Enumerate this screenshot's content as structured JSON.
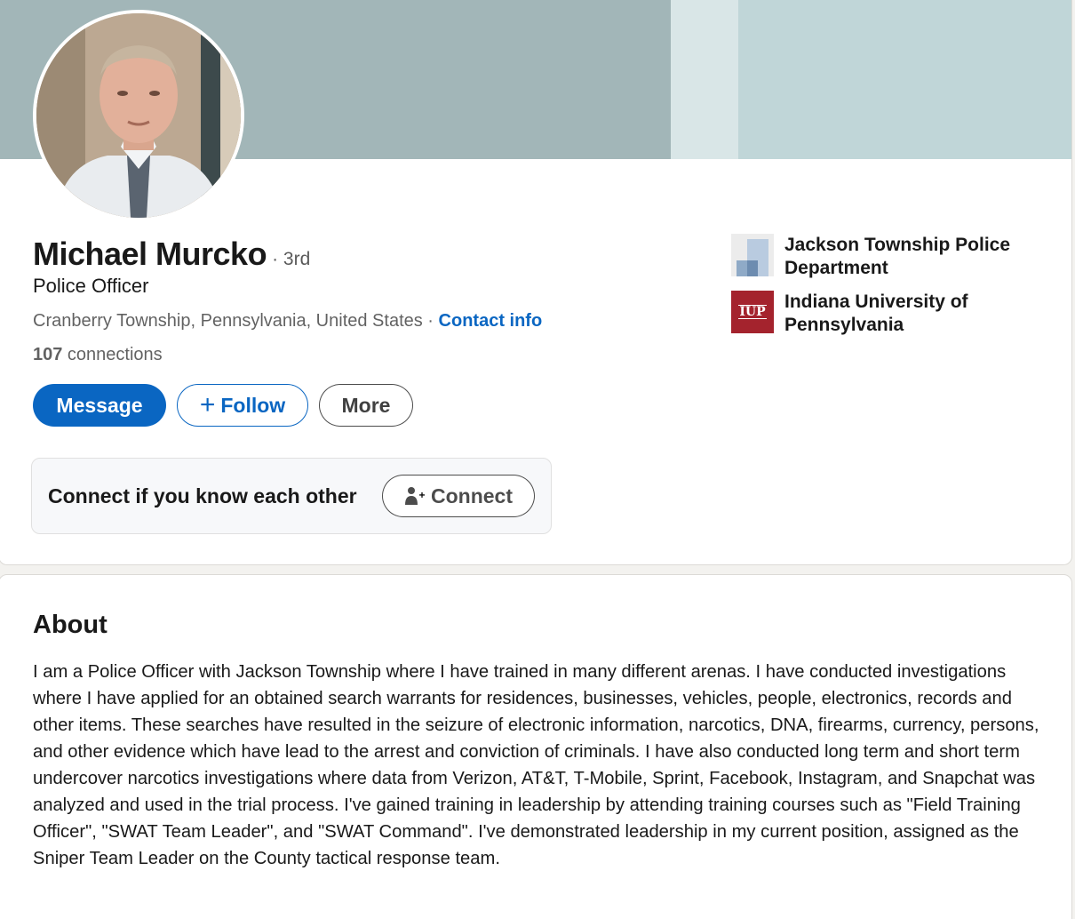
{
  "profile": {
    "name": "Michael Murcko",
    "degree": "· 3rd",
    "headline": "Police Officer",
    "location": "Cranberry Township, Pennsylvania, United States",
    "location_separator": " · ",
    "contact_info_label": "Contact info",
    "connections_count": "107",
    "connections_label": " connections"
  },
  "actions": {
    "message_label": "Message",
    "follow_icon": "+",
    "follow_label": "Follow",
    "more_label": "More"
  },
  "connect_prompt": {
    "text": "Connect if you know each other",
    "button_label": "Connect"
  },
  "organizations": [
    {
      "name": "Jackson Township Police Department",
      "logo": "jackson-township-logo"
    },
    {
      "name": "Indiana University of Pennsylvania",
      "logo_text": "IUP"
    }
  ],
  "about": {
    "title": "About",
    "text": "I am a Police Officer with Jackson Township where I have trained in many different arenas. I have conducted investigations where I have applied for an obtained search warrants for residences, businesses, vehicles, people, electronics, records and other items. These searches have resulted in the seizure of electronic information, narcotics, DNA, firearms, currency, persons, and other evidence which have lead to the arrest and conviction of criminals. I have also conducted long term and short term undercover narcotics investigations where data from Verizon, AT&T, T-Mobile, Sprint, Facebook, Instagram, and Snapchat was analyzed and used in the trial process. I've gained training in leadership by attending training courses such as \"Field Training Officer\", \"SWAT Team Leader\", and \"SWAT Command\". I've demonstrated leadership in my current position, assigned as the Sniper Team Leader on the County tactical response team."
  },
  "colors": {
    "accent": "#0a66c2",
    "banner_dark": "#a2b6b8",
    "banner_light": "#c0d6d8",
    "iup_red": "#a4232d"
  }
}
